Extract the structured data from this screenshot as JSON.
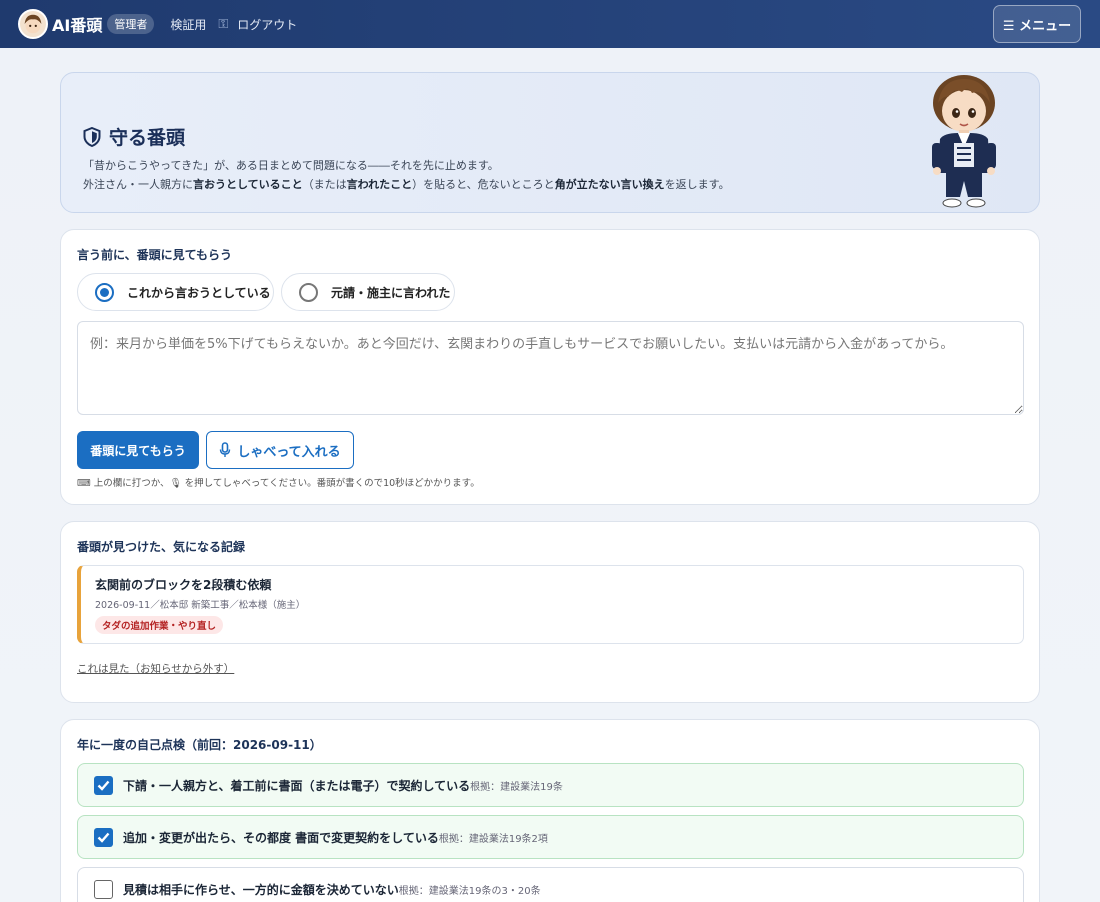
{
  "header": {
    "brand": "AI番頭",
    "role_badge": "管理者",
    "nav_verify": "検証用",
    "nav_logout": "ログアウト",
    "menu_label": "☰ メニュー"
  },
  "hero": {
    "title": "守る番頭",
    "line1": "「昔からこうやってきた」が、ある日まとめて問題になる――それを先に止めます。",
    "line2_a": "外注さん・一人親方に",
    "line2_b": "言おうとしていること",
    "line2_c": "（または",
    "line2_d": "言われたこと",
    "line2_e": "）を貼ると、危ないところと",
    "line2_f": "角が立たない言い換え",
    "line2_g": "を返します。"
  },
  "review": {
    "title": "言う前に、番頭に見てもらう",
    "option_1": "これから言おうとしている",
    "option_2": "元請・施主に言われた",
    "selected_option": 1,
    "placeholder": "例：来月から単価を5%下げてもらえないか。あと今回だけ、玄関まわりの手直しもサービスでお願いしたい。支払いは元請から入金があってから。",
    "value": "",
    "submit_label": "番頭に見てもらう",
    "voice_label": "しゃべって入れる",
    "hint": "⌨ 上の欄に打つか、🎙 を押してしゃべってください。番頭が書くので10秒ほどかかります。"
  },
  "records": {
    "title": "番頭が見つけた、気になる記録",
    "items": [
      {
        "title": "玄関前のブロックを2段積む依頼",
        "meta": "2026-09-11／松本邸 新築工事／松本様（施主）",
        "tag": "タダの追加作業・やり直し"
      }
    ],
    "dismiss_label": "これは見た（お知らせから外す）"
  },
  "selfcheck": {
    "title": "年に一度の自己点検（前回：2026-09-11）",
    "items": [
      {
        "label": "下請・一人親方と、着工前に書面（または電子）で契約している",
        "basis": "根拠：建設業法19条",
        "checked": true
      },
      {
        "label": "追加・変更が出たら、その都度 書面で変更契約をしている",
        "basis": "根拠：建設業法19条2項",
        "checked": true
      },
      {
        "label": "見積は相手に作らせ、一方的に金額を決めていない",
        "basis": "根拠：建設業法19条の3・20条",
        "checked": false
      }
    ]
  },
  "colors": {
    "header_bg": "#1f3a6e",
    "primary": "#1b6ec2",
    "record_accent": "#e8a33b",
    "tag_text": "#b42323",
    "check_ok_bg": "#f2fbf4"
  }
}
